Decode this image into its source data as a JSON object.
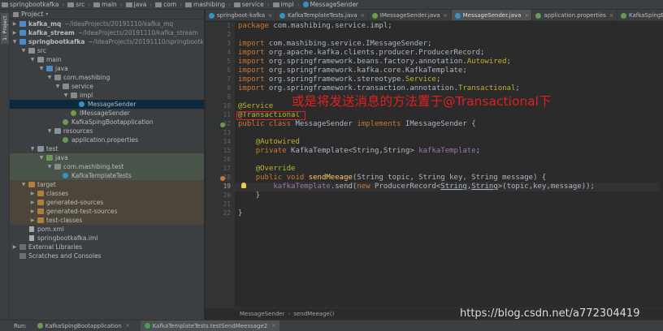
{
  "breadcrumb": [
    "springbootkafka",
    "src",
    "main",
    "java",
    "com",
    "mashibing",
    "service",
    "impl",
    "MessageSender"
  ],
  "left_strip": {
    "project_tab": "1: Project"
  },
  "project_panel": {
    "title": "Project",
    "tree": [
      {
        "label": "kafka_mq",
        "sub": "~/IdeaProjects/20191110/kafka_mq",
        "bold": true
      },
      {
        "label": "kafka_stream",
        "sub": "~/IdeaProjects/20191110/kafka_stream",
        "bold": true
      },
      {
        "label": "springbootkafka",
        "sub": "~/IdeaProjects/20191110/springbootkafka",
        "bold": true
      },
      {
        "label": "src"
      },
      {
        "label": "main"
      },
      {
        "label": "java"
      },
      {
        "label": "com.mashibing"
      },
      {
        "label": "service"
      },
      {
        "label": "impl"
      },
      {
        "label": "MessageSender"
      },
      {
        "label": "IMessageSender"
      },
      {
        "label": "KafkaSpingBootapplication"
      },
      {
        "label": "resources"
      },
      {
        "label": "application.properties"
      },
      {
        "label": "test"
      },
      {
        "label": "java"
      },
      {
        "label": "com.mashibing.test"
      },
      {
        "label": "KafkaTemplateTests"
      },
      {
        "label": "target"
      },
      {
        "label": "classes"
      },
      {
        "label": "generated-sources"
      },
      {
        "label": "generated-test-sources"
      },
      {
        "label": "test-classes"
      },
      {
        "label": "pom.xml"
      },
      {
        "label": "springbootkafka.iml"
      },
      {
        "label": "External Libraries"
      },
      {
        "label": "Scratches and Consoles"
      }
    ]
  },
  "tabs": [
    {
      "label": "springboot-kafka",
      "active": false
    },
    {
      "label": "KafkaTemplateTests.java",
      "active": false
    },
    {
      "label": "IMessageSender.java",
      "active": false
    },
    {
      "label": "MessageSender.java",
      "active": true
    },
    {
      "label": "application.properties",
      "active": false
    },
    {
      "label": "KafkaSpingBootapplication.ja",
      "active": false
    }
  ],
  "editor": {
    "line_numbers": [
      "1",
      "2",
      "3",
      "4",
      "5",
      "6",
      "7",
      "8",
      "9",
      "10",
      "11",
      "12",
      "13",
      "14",
      "15",
      "16",
      "17",
      "18",
      "19",
      "20",
      "21",
      "22"
    ],
    "current_line": "19",
    "annotation_text": "或是将发送消息的方法置于@Transactional下"
  },
  "editor_breadcrumb": [
    "MessageSender",
    "sendMeeage()"
  ],
  "run_bar": {
    "label": "Run:",
    "tabs": [
      "KafkaSpingBootapplication",
      "KafkaTemplateTests.testSendMeessage2"
    ]
  },
  "watermark": "https://blog.csdn.net/a772304419",
  "colors": {
    "background": "#2b2b2b",
    "panel": "#3c3f41",
    "keyword": "#cc7832",
    "annotation": "#bbb529",
    "field": "#9876aa",
    "method": "#ffc66d",
    "text": "#a9b7c6",
    "highlight_red": "#e02020",
    "selection": "#0d293e"
  }
}
